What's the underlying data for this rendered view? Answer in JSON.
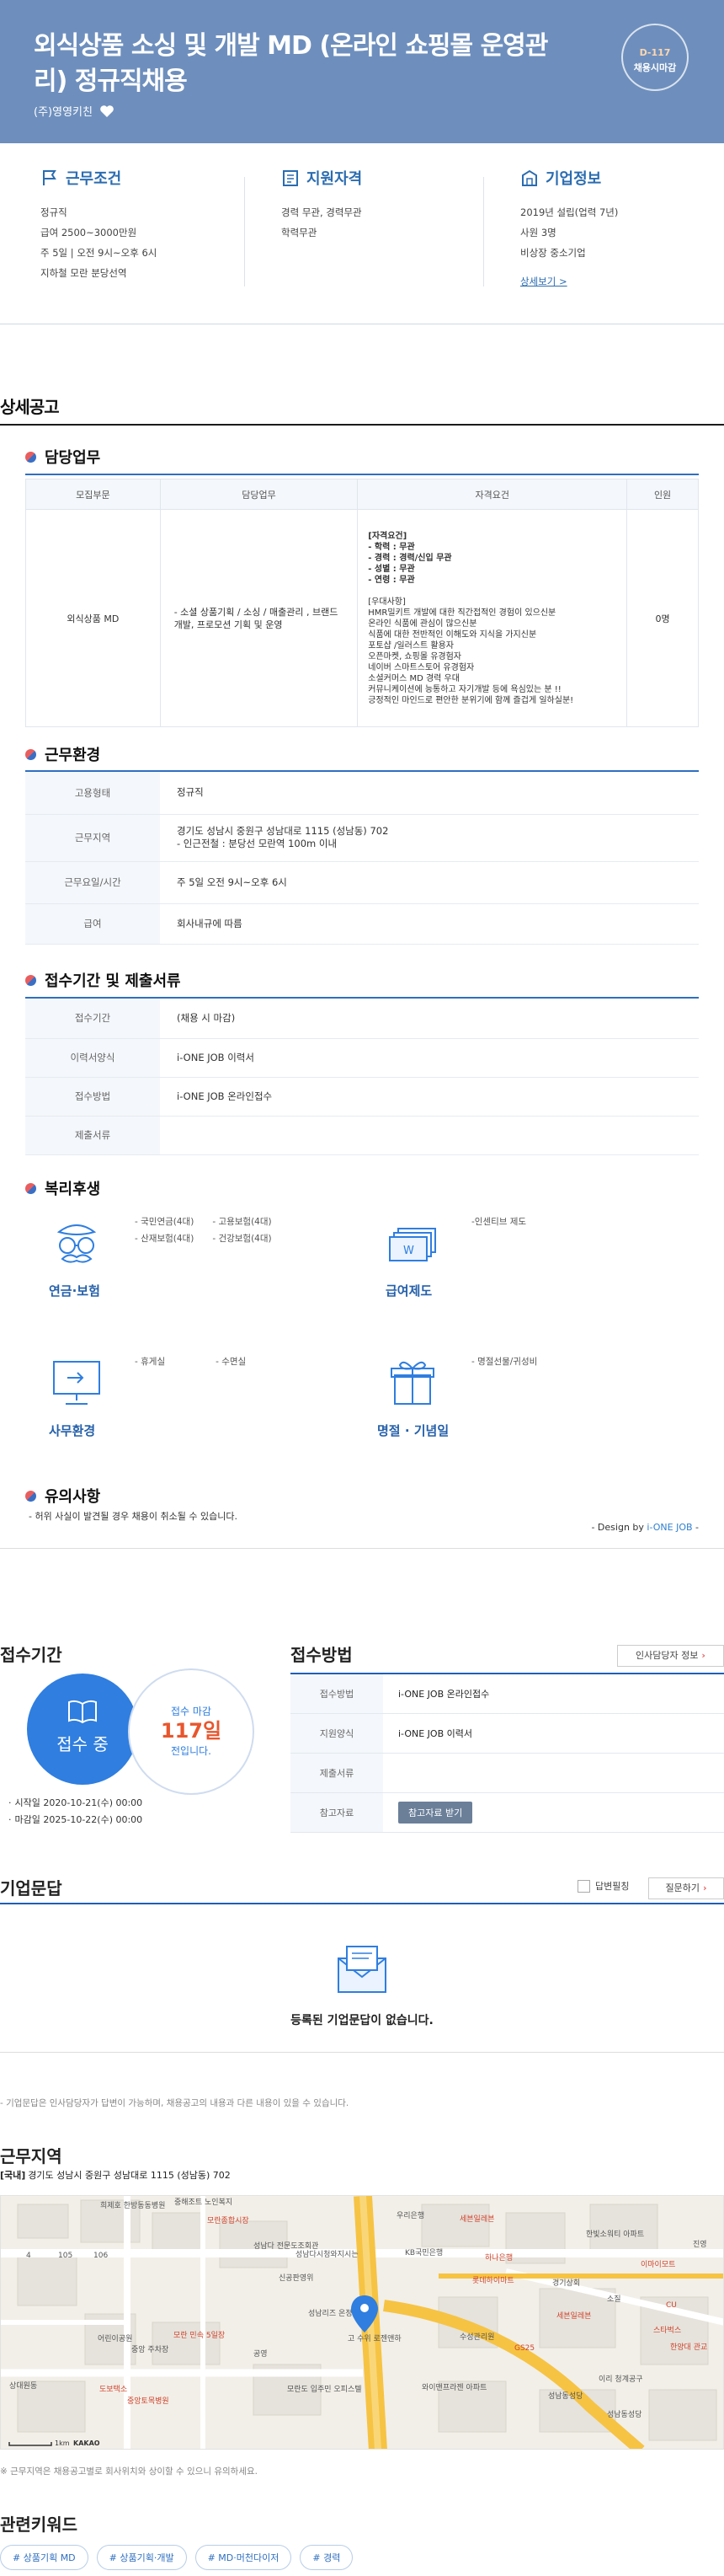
{
  "hero": {
    "title": "외식상품 소싱 및 개발 MD (온라인 쇼핑몰 운영관리) 정규직채용",
    "company": "(주)영영키친",
    "dday": "D-117",
    "dday_label": "채용시마감"
  },
  "summary": {
    "conditions": {
      "title": "근무조건",
      "items": [
        "정규직",
        "급여 2500~3000만원",
        "주 5일 | 오전 9시~오후 6시",
        "지하철 모란 분당선역"
      ]
    },
    "qualifications": {
      "title": "지원자격",
      "items": [
        "경력 무관, 경력무관",
        "학력무관"
      ]
    },
    "company_info": {
      "title": "기업정보",
      "items": [
        "2019년 설립(업력 7년)",
        "사원 3명",
        "비상장 중소기업"
      ],
      "link": "상세보기 >"
    }
  },
  "detail": {
    "section_title": "상세공고",
    "duty": {
      "title": "담당업무",
      "headers": [
        "모집부문",
        "담당업무",
        "자격요건",
        "인원"
      ],
      "row": {
        "part": "외식상품 MD",
        "task": "- 소셜 상품기획 / 소싱 / 매출관리 , 브랜드개발, 프로모션 기획 및 운영",
        "requirements": [
          "[자격요건]",
          "- 학력 : 무관",
          "- 경력 : 경력/신입 무관",
          "- 성별 : 무관",
          "- 연령 : 무관",
          "",
          "[우대사항]",
          "HMR밀키트 개발에 대한 직간접적인 경험이 있으신분",
          "온라인 식품에 관심이 많으신분",
          "식품에 대한 전반적인 이해도와 지식을 가지신분",
          "포토샵 /일러스트 활용자",
          "오픈마켓, 쇼핑몰 유경험자",
          "네이버 스마트스토어 유경험자",
          "소셜커머스 MD 경력 우대",
          "커뮤니케이션에 능통하고 자기개발 등에 욕심있는 분 !!",
          "긍정적인 마인드로 편안한 분위기에 함께 즐겁게 일하실분!"
        ],
        "count": "0명"
      }
    },
    "environment": {
      "title": "근무환경",
      "rows": [
        {
          "label": "고용형태",
          "value": "정규직"
        },
        {
          "label": "근무지역",
          "value": "경기도 성남시 중원구 성남대로 1115 (성남동) 702",
          "value2": "- 인근전철 : 분당선 모란역 100m 이내"
        },
        {
          "label": "근무요일/시간",
          "value": "주 5일 오전 9시~오후 6시"
        },
        {
          "label": "급여",
          "value": "회사내규에 따름"
        }
      ]
    },
    "reception": {
      "title": "접수기간 및 제출서류",
      "rows": [
        {
          "label": "접수기간",
          "value": "(채용 시 마감)"
        },
        {
          "label": "이력서양식",
          "value": "i-ONE JOB 이력서"
        },
        {
          "label": "접수방법",
          "value": "i-ONE JOB 온라인접수"
        },
        {
          "label": "제출서류",
          "value": ""
        }
      ]
    },
    "welfare": {
      "title": "복리후생",
      "groups": [
        {
          "label": "연금·보험",
          "icon": "glasses-mustache-icon",
          "items": [
            "- 국민연금(4대)",
            "- 고용보험(4대)",
            "- 산재보험(4대)",
            "- 건강보험(4대)"
          ]
        },
        {
          "label": "급여제도",
          "icon": "money-bills-icon",
          "items": [
            "-인센티브 제도"
          ]
        },
        {
          "label": "사무환경",
          "icon": "monitor-icon",
          "items": [
            "- 휴게실",
            "- 수면실"
          ]
        },
        {
          "label": "명절 · 기념일",
          "icon": "gift-icon",
          "items": [
            "- 명절선물/귀성비"
          ]
        }
      ]
    },
    "caution": {
      "title": "유의사항",
      "text": "- 허위 사실이 발견될 경우 채용이 취소될 수 있습니다."
    },
    "design_by": {
      "prefix": "- Design by ",
      "brand": "i-ONE JOB",
      "suffix": " -"
    }
  },
  "period": {
    "title": "접수기간",
    "status": "접수 중",
    "remain_label": "접수 마감",
    "remain_days": "117일",
    "remain_suffix": "전입니다.",
    "start": "시작일 2020-10-21(수) 00:00",
    "end": "마감일 2025-10-22(수) 00:00"
  },
  "method": {
    "title": "접수방법",
    "hr_button": "인사담당자 정보",
    "rows": [
      {
        "label": "접수방법",
        "value": "i-ONE JOB 온라인접수"
      },
      {
        "label": "지원양식",
        "value": "i-ONE JOB 이력서"
      },
      {
        "label": "제출서류",
        "value": ""
      },
      {
        "label": "참고자료",
        "value": ""
      }
    ],
    "ref_button": "참고자료 받기"
  },
  "qa": {
    "title": "기업문답",
    "check_label": "답변필칭",
    "ask_button": "질문하기",
    "empty": "등록된 기업문답이 없습니다.",
    "note": "- 기업문답은 인사담당자가 답변이 가능하며, 채용공고의 내용과 다른 내용이 있을 수 있습니다."
  },
  "map": {
    "title": "근무지역",
    "addr_tag": "[국내]",
    "address": "경기도 성남시 중원구 성남대로 1115 (성남동) 702",
    "labels": [
      "희제호 한방동동병원",
      "헌재 안현",
      "중해조트 노인복지",
      "모란종합시장",
      "우리은행",
      "세븐일레븐",
      "보해건강",
      "한빛소워티 아파트",
      "진영",
      "성남다 전문도조회관",
      "성남다시청와지시는 지하출용",
      "KB국민은행",
      "하나은행",
      "롯데하이마트",
      "이마이모트",
      "경기상회",
      "세븐일레븐",
      "소질",
      "CU",
      "한양대 관교",
      "성남리즈 온정원",
      "고 수위 로젠앤하",
      "수성관리원",
      "GS25",
      "스타벅스",
      "모란 민속 5일장",
      "어린이공원",
      "중앙 주차장",
      "도보택소",
      "공영",
      "모란도 입주민 오피스텔",
      "와이맨프라젠 아파트",
      "성남동성당",
      "성남동성당",
      "이리 청계공구",
      "중앙토목병원",
      "신공판영위",
      "4",
      "105",
      "106",
      "상대원동",
      "1km",
      "KAKAO"
    ],
    "note": "※ 근무지역은 채용공고별로 회사위치와 상이할 수 있으니 유의하세요."
  },
  "keywords": {
    "title": "관련키워드",
    "items": [
      "# 상품기획 MD",
      "# 상품기획·개발",
      "# MD·머천다이저",
      "# 경력"
    ]
  }
}
